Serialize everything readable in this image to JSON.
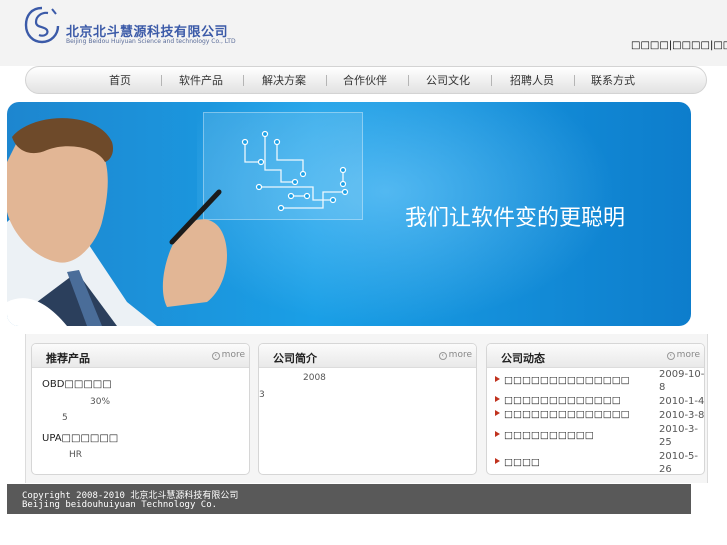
{
  "header": {
    "company_name_cn": "北京北斗慧源科技有限公司",
    "company_name_en": "Beijing Beidou Huiyuan Science and technology Co., LTD",
    "top_links": "□□□□|□□□□|□□□□"
  },
  "nav": {
    "items": [
      {
        "label": "首页"
      },
      {
        "label": "软件产品"
      },
      {
        "label": "解决方案"
      },
      {
        "label": "合作伙伴"
      },
      {
        "label": "公司文化"
      },
      {
        "label": "招聘人员"
      },
      {
        "label": "联系方式"
      }
    ]
  },
  "banner": {
    "slogan": "我们让软件变的更聪明"
  },
  "boxes": {
    "products": {
      "title": "推荐产品",
      "more": "more",
      "items": [
        {
          "name": "OBD□□□□□",
          "line1": "30%",
          "line2": "5"
        },
        {
          "name": "UPA□□□□□□",
          "line1": "HR"
        }
      ]
    },
    "about": {
      "title": "公司简介",
      "more": "more",
      "text1": "2008",
      "text2": "3"
    },
    "news": {
      "title": "公司动态",
      "more": "more",
      "items": [
        {
          "title": "□□□□□□□□□□□□□□",
          "date": "2009-10-8"
        },
        {
          "title": "□□□□□□□□□□□□□",
          "date": "2010-1-4"
        },
        {
          "title": "□□□□□□□□□□□□□□",
          "date": "2010-3-8"
        },
        {
          "title": "□□□□□□□□□□",
          "date": "2010-3-25"
        },
        {
          "title": "□□□□",
          "date": "2010-5-26"
        }
      ]
    }
  },
  "footer": {
    "line1": "Copyright 2008-2010 北京北斗慧源科技有限公司",
    "line2": "Beijing beidouhuiyuan Technology Co."
  },
  "colors": {
    "brand_blue": "#3b5aa8",
    "banner_blue": "#1a9fe6",
    "footer_gray": "#595959",
    "news_arrow": "#c0321e"
  },
  "icons": {
    "logo": "circular-logo-icon",
    "more": "circle-arrow-icon",
    "news_bullet": "triangle-right-icon"
  }
}
